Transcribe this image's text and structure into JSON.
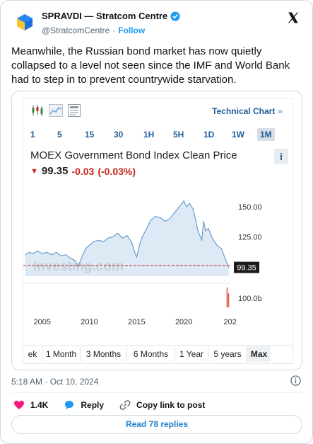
{
  "author": {
    "name": "SPRAVDI — Stratcom Centre",
    "handle": "@StratcomCentre",
    "separator": "·",
    "follow_label": "Follow"
  },
  "tweet": {
    "text": "Meanwhile, the Russian bond market has now quietly collapsed to a level not seen since the IMF and World Bank had to step in to prevent countrywide starvation.",
    "timestamp": "5:18 AM · Oct 10, 2024"
  },
  "widget": {
    "technical_chart_label": "Technical Chart",
    "technical_chart_chevron": "»",
    "timeframes": [
      "1",
      "5",
      "15",
      "30",
      "1H",
      "5H",
      "1D",
      "1W",
      "1M"
    ],
    "active_timeframe": "1M",
    "title": "MOEX Government Bond Index Clean Price",
    "info_label": "i",
    "price": "99.35",
    "change": "-0.03",
    "change_pct": "(-0.03%)",
    "watermark": "Investing.com",
    "ranges": [
      "ek",
      "1 Month",
      "3 Months",
      "6 Months",
      "1 Year",
      "5 years",
      "Max"
    ],
    "active_range": "Max"
  },
  "chart_data": {
    "type": "area",
    "title": "MOEX Government Bond Index Clean Price",
    "x": [
      2003.2,
      2003.6,
      2004.0,
      2004.5,
      2005.0,
      2005.5,
      2006.0,
      2006.5,
      2007.0,
      2007.5,
      2008.0,
      2008.5,
      2008.8,
      2009.0,
      2009.3,
      2009.6,
      2010.0,
      2010.5,
      2011.0,
      2011.5,
      2012.0,
      2012.5,
      2013.0,
      2013.5,
      2014.0,
      2014.5,
      2014.8,
      2015.0,
      2015.3,
      2015.6,
      2016.0,
      2016.5,
      2017.0,
      2017.5,
      2018.0,
      2018.5,
      2019.0,
      2019.5,
      2020.0,
      2020.3,
      2020.6,
      2021.0,
      2021.5,
      2021.9,
      2022.1,
      2022.3,
      2022.6,
      2023.0,
      2023.5,
      2024.0,
      2024.4,
      2024.75
    ],
    "values": [
      110,
      112,
      111,
      113,
      111,
      112,
      110,
      112,
      109,
      110,
      107,
      105,
      100,
      104,
      110,
      115,
      118,
      121,
      122,
      121,
      124,
      125,
      128,
      124,
      126,
      120,
      112,
      108,
      118,
      125,
      131,
      139,
      142,
      141,
      138,
      140,
      145,
      150,
      155,
      150,
      153,
      148,
      130,
      122,
      138,
      130,
      132,
      124,
      118,
      115,
      106,
      99.35
    ],
    "volume_x": [
      2024.6,
      2024.75
    ],
    "volume_values": [
      1.0,
      0.7
    ],
    "xlim": [
      2003,
      2025
    ],
    "ylim": [
      92,
      162
    ],
    "x_ticks": [
      "2005",
      "2010",
      "2015",
      "2020",
      "202"
    ],
    "y_ticks": [
      "150.00",
      "125.00"
    ],
    "volume_tick": "100.0b",
    "last_value_label": "99.35",
    "reference_line": 101,
    "grid": false,
    "colors": {
      "line": "#6b9fd1",
      "fill": "#dde9f5",
      "ref_line": "#c4261d",
      "volume": "#e05a4f",
      "label_bg": "#1b1b1b"
    }
  },
  "footer": {
    "likes": "1.4K",
    "reply_label": "Reply",
    "copy_link_label": "Copy link to post",
    "read_replies_label": "Read 78 replies"
  },
  "icons": [
    "avatar-logo",
    "verified-badge-icon",
    "x-logo-icon",
    "candlestick-icon",
    "line-chart-icon",
    "indicator-icon",
    "info-icon",
    "heart-icon",
    "reply-icon",
    "link-icon"
  ]
}
